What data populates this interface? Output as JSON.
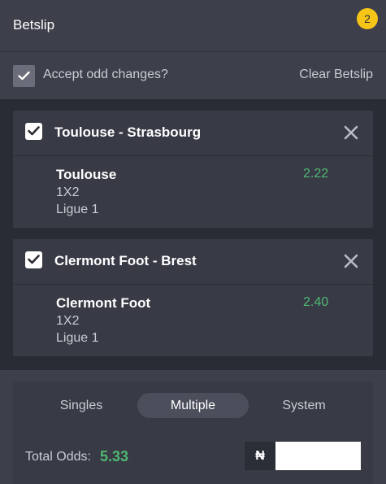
{
  "header": {
    "title": "Betslip",
    "count": "2"
  },
  "options": {
    "accept_label": "Accept odd changes?",
    "clear_label": "Clear Betslip"
  },
  "bets": [
    {
      "event": "Toulouse - Strasbourg",
      "selection": "Toulouse",
      "market": "1X2",
      "league": "Ligue 1",
      "odds": "2.22"
    },
    {
      "event": "Clermont Foot - Brest",
      "selection": "Clermont Foot",
      "market": "1X2",
      "league": "Ligue 1",
      "odds": "2.40"
    }
  ],
  "tabs": {
    "singles": "Singles",
    "multiple": "Multiple",
    "system": "System",
    "active": "Multiple"
  },
  "totals": {
    "label": "Total Odds:",
    "value": "5.33",
    "currency": "₦",
    "stake_value": "",
    "stake_placeholder": ""
  },
  "colors": {
    "badge": "#f5c518",
    "odds": "#4fb872",
    "background": "#2a2c35"
  }
}
